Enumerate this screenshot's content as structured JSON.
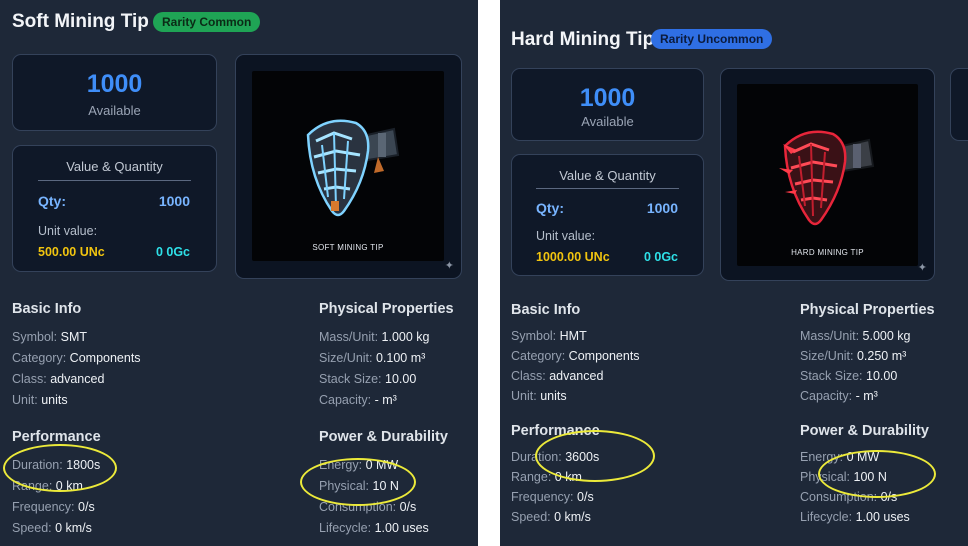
{
  "left": {
    "title": "Soft Mining Tip",
    "rarity": "Rarity Common",
    "available": {
      "value": "1000",
      "label": "Available"
    },
    "value_quantity": {
      "title": "Value & Quantity",
      "qty_label": "Qty:",
      "qty_value": "1000",
      "unit_value_label": "Unit value:",
      "unc": "500.00 UNc",
      "gc": "0 0Gc"
    },
    "image_caption": "SOFT MINING TIP",
    "basic_info": {
      "heading": "Basic Info",
      "rows": [
        {
          "label": "Symbol: ",
          "value": "SMT"
        },
        {
          "label": "Category: ",
          "value": "Components"
        },
        {
          "label": "Class: ",
          "value": "advanced"
        },
        {
          "label": "Unit: ",
          "value": "units"
        }
      ]
    },
    "physical": {
      "heading": "Physical Properties",
      "rows": [
        {
          "label": "Mass/Unit: ",
          "value": "1.000 kg"
        },
        {
          "label": "Size/Unit: ",
          "value": "0.100 m³"
        },
        {
          "label": "Stack Size: ",
          "value": "10.00"
        },
        {
          "label": "Capacity: ",
          "value": "- m³"
        }
      ]
    },
    "performance": {
      "heading": "Performance",
      "rows": [
        {
          "label": "Duration: ",
          "value": "1800s"
        },
        {
          "label": "Range: ",
          "value": "0 km"
        },
        {
          "label": "Frequency: ",
          "value": "0/s"
        },
        {
          "label": "Speed: ",
          "value": "0 km/s"
        }
      ]
    },
    "power": {
      "heading": "Power & Durability",
      "rows": [
        {
          "label": "Energy: ",
          "value": "0 MW"
        },
        {
          "label": "Physical: ",
          "value": "10 N"
        },
        {
          "label": "Consumption: ",
          "value": "0/s"
        },
        {
          "label": "Lifecycle: ",
          "value": "1.00 uses"
        }
      ]
    }
  },
  "right": {
    "title": "Hard Mining Tip",
    "rarity": "Rarity Uncommon",
    "available": {
      "value": "1000",
      "label": "Available"
    },
    "value_quantity": {
      "title": "Value & Quantity",
      "qty_label": "Qty:",
      "qty_value": "1000",
      "unit_value_label": "Unit value:",
      "unc": "1000.00 UNc",
      "gc": "0 0Gc"
    },
    "image_caption": "HARD MINING TIP",
    "basic_info": {
      "heading": "Basic Info",
      "rows": [
        {
          "label": "Symbol: ",
          "value": "HMT"
        },
        {
          "label": "Category: ",
          "value": "Components"
        },
        {
          "label": "Class: ",
          "value": "advanced"
        },
        {
          "label": "Unit: ",
          "value": "units"
        }
      ]
    },
    "physical": {
      "heading": "Physical Properties",
      "rows": [
        {
          "label": "Mass/Unit: ",
          "value": "5.000 kg"
        },
        {
          "label": "Size/Unit: ",
          "value": "0.250 m³"
        },
        {
          "label": "Stack Size: ",
          "value": "10.00"
        },
        {
          "label": "Capacity: ",
          "value": "- m³"
        }
      ]
    },
    "performance": {
      "heading": "Performance",
      "rows": [
        {
          "label": "Duration: ",
          "value": "3600s"
        },
        {
          "label": "Range: ",
          "value": "0 km"
        },
        {
          "label": "Frequency: ",
          "value": "0/s"
        },
        {
          "label": "Speed: ",
          "value": "0 km/s"
        }
      ]
    },
    "power": {
      "heading": "Power & Durability",
      "rows": [
        {
          "label": "Energy: ",
          "value": "0 MW"
        },
        {
          "label": "Physical: ",
          "value": "100 N"
        },
        {
          "label": "Consumption: ",
          "value": "0/s"
        },
        {
          "label": "Lifecycle: ",
          "value": "1.00 uses"
        }
      ]
    }
  },
  "colors": {
    "panel_bg": "#1e2838",
    "card_bg": "#0f1828",
    "available_blue": "#3f8ef8",
    "qty_blue": "#78b4ff",
    "unc_yellow": "#f1c40f",
    "gc_cyan": "#2ee0e8",
    "badge_common": "#1fa455",
    "badge_uncommon": "#2f6fe4",
    "highlight_ellipse": "#ecea3a",
    "soft_tip_glow": "#7fd3ff",
    "hard_tip_glow": "#e8253a"
  },
  "icons": {
    "image_corner": "sparkle-icon",
    "left_item": "soft-mining-tip-icon",
    "right_item": "hard-mining-tip-icon"
  }
}
